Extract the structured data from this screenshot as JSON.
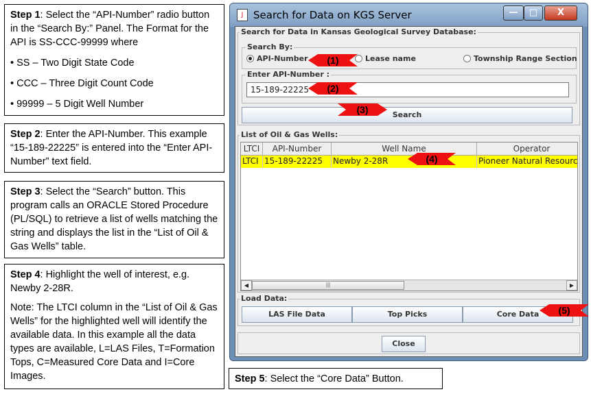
{
  "steps": {
    "step1": {
      "title": "Step 1",
      "text": ": Select the “API-Number” radio button in the “Search By:” Panel.  The Format for the API is SS-CCC-99999 where",
      "bullets": [
        "• SS – Two Digit State Code",
        "• CCC – Three Digit Count Code",
        "• 99999 – 5 Digit Well Number"
      ]
    },
    "step2": {
      "title": "Step 2",
      "text": ": Enter the API-Number. This example “15-189-22225” is entered into the “Enter API-Number” text field."
    },
    "step3": {
      "title": "Step 3",
      "text": ": Select the “Search” button.  This program calls an ORACLE Stored Procedure (PL/SQL) to retrieve a list of wells matching the string and displays the list in the “List of Oil & Gas Wells” table."
    },
    "step4": {
      "title": "Step 4",
      "text": ": Highlight the well of interest, e.g. Newby 2-28R.",
      "note": "Note: The LTCI column in the “List of Oil & Gas Wells” for the highlighted well will identify the available data. In this example all the data types are available, L=LAS Files, T=Formation Tops, C=Measured Core Data and I=Core Images."
    },
    "step5": {
      "title": "Step 5",
      "text": ": Select the “Core Data” Button."
    }
  },
  "window": {
    "title": "Search for Data on KGS Server",
    "icon_label": "J",
    "min_glyph": "—",
    "max_glyph": "□",
    "close_glyph": "X"
  },
  "search_panel": {
    "label": "Search for Data in Kansas Geological Survey Database:",
    "search_by_label": "Search By:",
    "radios": [
      {
        "label": "API-Number",
        "selected": true
      },
      {
        "label": "Lease name",
        "selected": false
      },
      {
        "label": "Township Range Section",
        "selected": false
      }
    ],
    "api_label": "Enter API-Number :",
    "api_value": "15-189-22225",
    "search_button": "Search"
  },
  "wells_panel": {
    "label": "List of Oil & Gas Wells:",
    "columns": [
      "LTCI",
      "API-Number",
      "Well Name",
      "Operator"
    ],
    "rows": [
      {
        "ltci": "LTCI",
        "api": "15-189-22225",
        "well_name": "Newby 2-28R",
        "operator": "Pioneer Natural Resource",
        "highlighted": true
      }
    ],
    "scroll_left": "◀",
    "scroll_right": "▶",
    "scroll_grip": "|||"
  },
  "load_panel": {
    "label": "Load Data:",
    "buttons": [
      "LAS File Data",
      "Top Picks",
      "Core Data"
    ]
  },
  "close_button": "Close",
  "annotations": [
    "(1)",
    "(2)",
    "(3)",
    "(4)",
    "(5)"
  ],
  "colors": {
    "arrow_red": "#ee1111",
    "row_highlight": "#ffff00",
    "window_frame": "#6b8fb5"
  }
}
